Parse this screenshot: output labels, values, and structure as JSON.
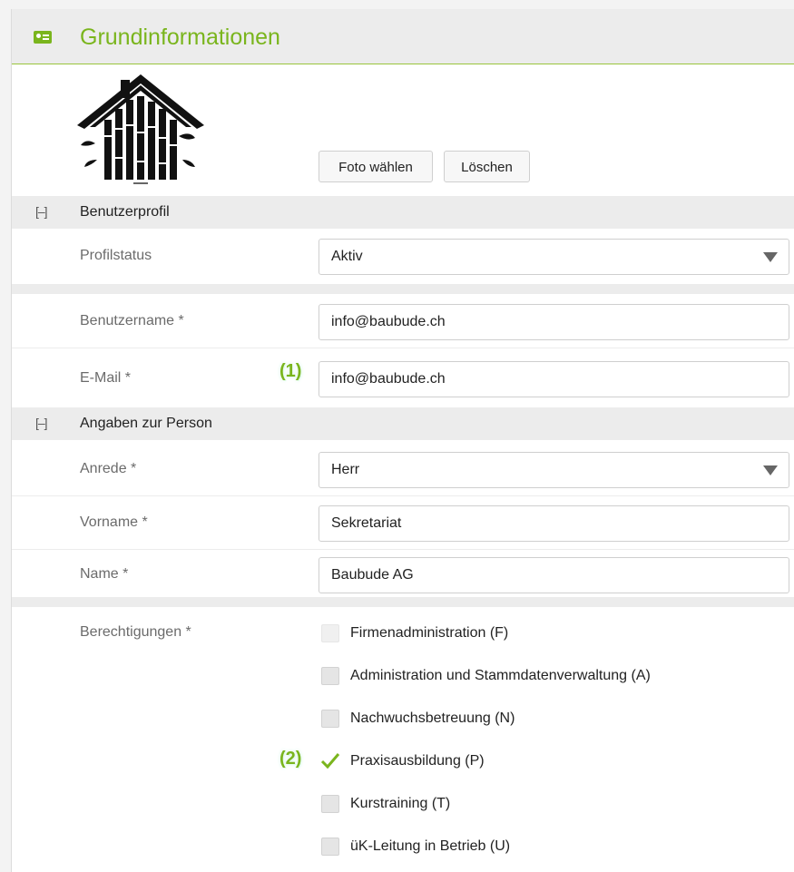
{
  "header": {
    "title": "Grundinformationen",
    "icon": "id-card-icon",
    "accent": "#7ab51d"
  },
  "photo": {
    "choose_label": "Foto wählen",
    "delete_label": "Löschen"
  },
  "sections": {
    "profile": {
      "toggle": "[–]",
      "title": "Benutzerprofil"
    },
    "person": {
      "toggle": "[–]",
      "title": "Angaben zur Person"
    }
  },
  "fields": {
    "profile_status": {
      "label": "Profilstatus",
      "value": "Aktiv"
    },
    "username": {
      "label": "Benutzername *",
      "value": "info@baubude.ch"
    },
    "email": {
      "label": "E-Mail *",
      "value": "info@baubude.ch"
    },
    "salutation": {
      "label": "Anrede *",
      "value": "Herr"
    },
    "firstname": {
      "label": "Vorname *",
      "value": "Sekretariat"
    },
    "name": {
      "label": "Name *",
      "value": "Baubude AG"
    }
  },
  "permissions": {
    "label": "Berechtigungen *",
    "items": [
      {
        "label": "Firmenadministration (F)",
        "checked": false
      },
      {
        "label": "Administration und Stammdatenverwaltung (A)",
        "checked": false
      },
      {
        "label": "Nachwuchsbetreuung (N)",
        "checked": false
      },
      {
        "label": "Praxisausbildung (P)",
        "checked": true
      },
      {
        "label": "Kurstraining (T)",
        "checked": false
      },
      {
        "label": "üK-Leitung in Betrieb (U)",
        "checked": false
      }
    ]
  },
  "annotations": {
    "one": "(1)",
    "two": "(2)"
  }
}
